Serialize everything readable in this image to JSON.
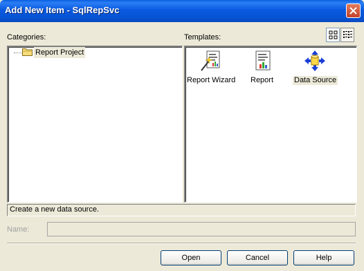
{
  "window": {
    "title": "Add New Item - SqlRepSvc"
  },
  "categories": {
    "label": "Categories:",
    "items": [
      {
        "label": "Report Project",
        "selected": true
      }
    ]
  },
  "templates": {
    "label": "Templates:",
    "items": [
      {
        "label": "Report Wizard",
        "icon": "report-wizard-icon",
        "selected": false
      },
      {
        "label": "Report",
        "icon": "report-icon",
        "selected": false
      },
      {
        "label": "Data Source",
        "icon": "data-source-icon",
        "selected": true
      }
    ]
  },
  "view_toggle": {
    "selected": "large-icons"
  },
  "description": "Create a new data source.",
  "name_field": {
    "label": "Name:",
    "value": ""
  },
  "buttons": {
    "open": "Open",
    "cancel": "Cancel",
    "help": "Help"
  },
  "colors": {
    "title_bar": "#0a5ae0",
    "dialog_bg": "#ece9d8",
    "close_button": "#c2412a",
    "selection": "#ece9d8"
  }
}
